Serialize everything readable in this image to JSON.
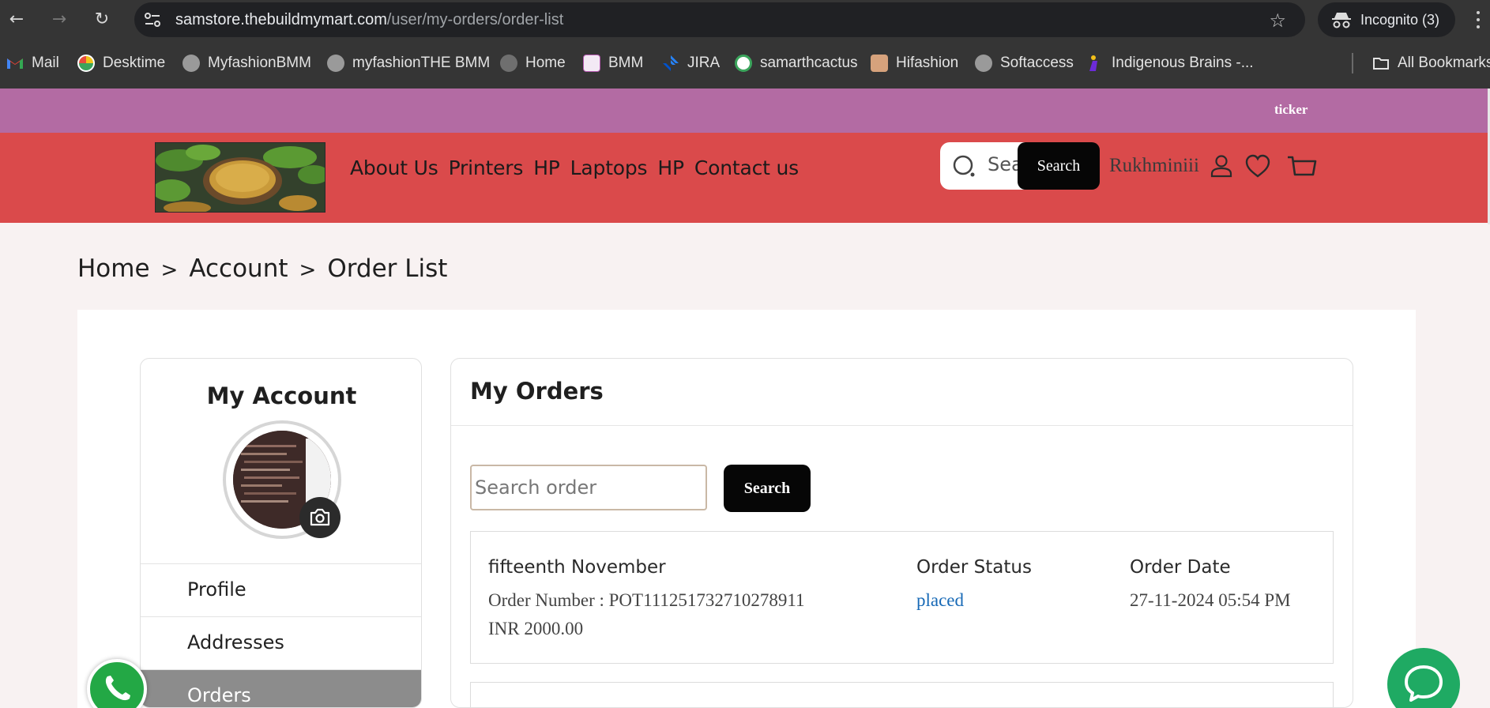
{
  "browser": {
    "url_host": "samstore.thebuildmymart.com",
    "url_path": "/user/my-orders/order-list",
    "incognito_label": "Incognito (3)",
    "bookmarks": [
      {
        "label": "Mail",
        "icon": "gmail-icon"
      },
      {
        "label": "Desktime",
        "icon": "desktime-icon"
      },
      {
        "label": "MyfashionBMM",
        "icon": "globe-icon"
      },
      {
        "label": "myfashionTHE BMM",
        "icon": "globe-icon"
      },
      {
        "label": "Home",
        "icon": "globe-icon"
      },
      {
        "label": "BMM",
        "icon": "bmm-icon"
      },
      {
        "label": "JIRA",
        "icon": "jira-icon"
      },
      {
        "label": "samarthcactus",
        "icon": "cactus-icon"
      },
      {
        "label": "Hifashion",
        "icon": "hifashion-icon"
      },
      {
        "label": "Softaccess",
        "icon": "globe-icon"
      },
      {
        "label": "Indigenous Brains -...",
        "icon": "indigenous-icon"
      }
    ],
    "all_bookmarks_label": "All Bookmarks"
  },
  "site": {
    "ticker_text": "ticker",
    "nav": [
      "About Us",
      "Printers",
      "HP",
      "Laptops",
      "HP",
      "Contact us"
    ],
    "search_placeholder": "Search",
    "search_button": "Search",
    "user_name": "Rukhminiii",
    "colors": {
      "ticker": "#b36ba3",
      "header": "#da4a4b",
      "status": "#1769b6"
    }
  },
  "breadcrumb": [
    "Home",
    "Account",
    "Order List"
  ],
  "account": {
    "title": "My Account",
    "menu": [
      "Profile",
      "Addresses",
      "Orders"
    ],
    "active": "Orders"
  },
  "orders": {
    "title": "My Orders",
    "search_placeholder": "Search order",
    "search_button": "Search",
    "items": [
      {
        "name": "fifteenth November",
        "order_number": "Order Number : POT111251732710278911",
        "amount": "INR 2000.00",
        "status_heading": "Order Status",
        "status": "placed",
        "date_heading": "Order Date",
        "date": "27-11-2024 05:54 PM"
      }
    ]
  }
}
